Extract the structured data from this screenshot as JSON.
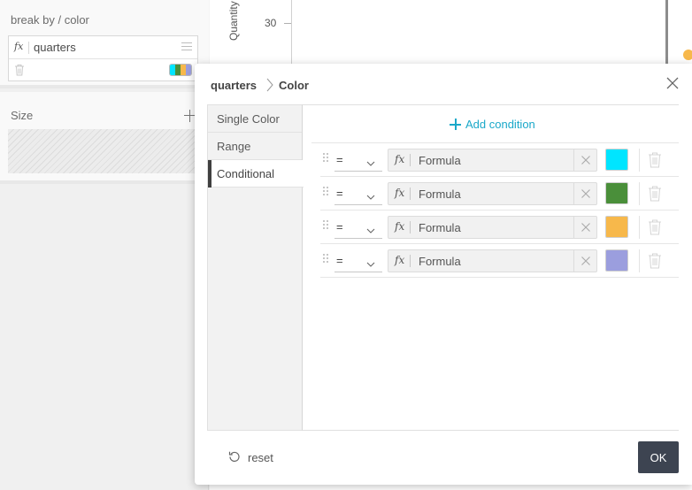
{
  "left_panel": {
    "break_by": {
      "title": "break by / color",
      "field_label": "quarters",
      "fx_glyph": "fx",
      "palette": [
        "#00e5ff",
        "#4a8f3a",
        "#f7b84b",
        "#9b9ede"
      ]
    },
    "size": {
      "title": "Size"
    }
  },
  "chart": {
    "tick_label": "30",
    "y_axis_title": "Quantity",
    "point_color": "#f7b84b"
  },
  "dialog": {
    "breadcrumb": {
      "first": "quarters",
      "second": "Color"
    },
    "tabs": [
      {
        "label": "Single Color",
        "active": false
      },
      {
        "label": "Range",
        "active": false
      },
      {
        "label": "Conditional",
        "active": true
      }
    ],
    "add_condition_label": "Add condition",
    "conditions": [
      {
        "operator": "=",
        "fx": "fx",
        "formula": "Formula",
        "color": "#00e5ff"
      },
      {
        "operator": "=",
        "fx": "fx",
        "formula": "Formula",
        "color": "#4a8f3a"
      },
      {
        "operator": "=",
        "fx": "fx",
        "formula": "Formula",
        "color": "#f7b84b"
      },
      {
        "operator": "=",
        "fx": "fx",
        "formula": "Formula",
        "color": "#9b9ede"
      }
    ],
    "footer": {
      "reset_label": "reset",
      "ok_label": "OK"
    }
  },
  "colors": {
    "accent": "#1aa8c9",
    "primary_button": "#3d4451"
  }
}
